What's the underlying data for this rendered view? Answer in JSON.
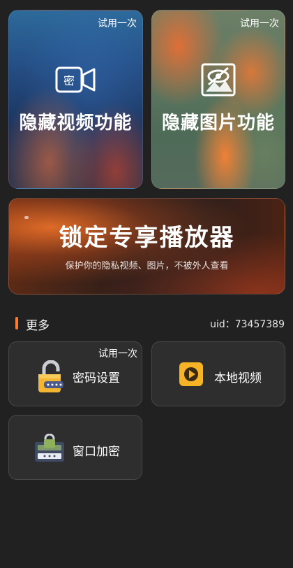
{
  "cards": {
    "video": {
      "trial": "试用一次",
      "title": "隐藏视频功能",
      "icon_text": "密"
    },
    "photo": {
      "trial": "试用一次",
      "title": "隐藏图片功能"
    }
  },
  "banner": {
    "title": "锁定专享播放器",
    "subtitle": "保护你的隐私视频、图片，不被外人查看"
  },
  "more": {
    "title": "更多",
    "uid": "uid：73457389"
  },
  "tiles": {
    "password": {
      "label": "密码设置",
      "trial": "试用一次"
    },
    "local_video": {
      "label": "本地视频"
    },
    "window_lock": {
      "label": "窗口加密"
    }
  },
  "colors": {
    "accent": "#ff7a2e",
    "background": "#222121",
    "tile": "#2f2e2e"
  }
}
